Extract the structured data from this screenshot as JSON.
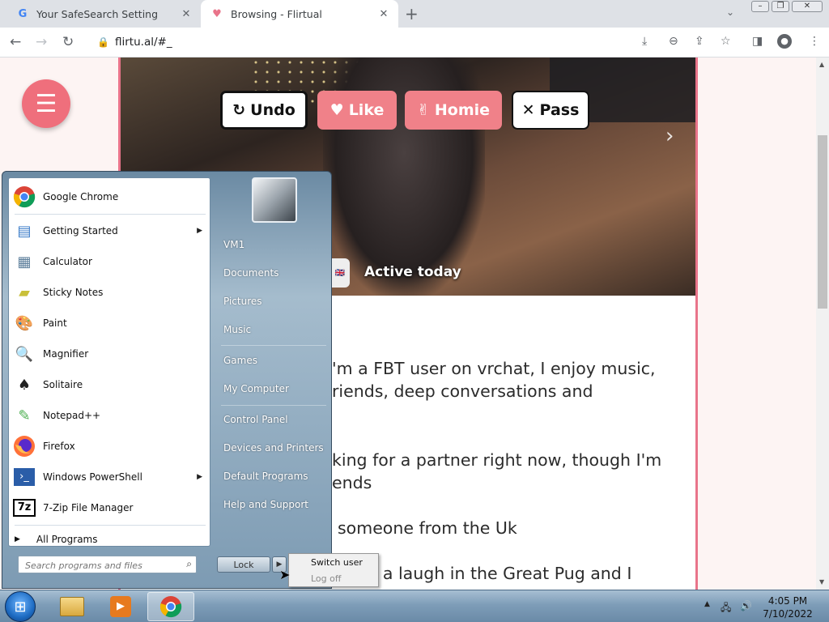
{
  "browser": {
    "tabs": [
      {
        "favicon": "G",
        "title": "Your SafeSearch Setting"
      },
      {
        "favicon": "♥",
        "title": "Browsing - Flirtual"
      }
    ],
    "url": "flirtu.al/#_"
  },
  "page": {
    "actions": [
      {
        "icon": "↻",
        "label": "Undo"
      },
      {
        "icon": "♥",
        "label": "Like"
      },
      {
        "icon": "✌",
        "label": "Homie"
      },
      {
        "icon": "✕",
        "label": "Pass"
      }
    ],
    "status": "Active today",
    "bio_lines": [
      "'m a FBT user on vrchat, I enjoy music,",
      "riends, deep conversations and",
      "king for a partner right now, though I'm",
      "ends",
      "someone from the Uk",
      "aving  a laugh in the Great Pug and I"
    ],
    "accent_color": "#f08189"
  },
  "start_menu": {
    "programs": [
      {
        "label": "Google Chrome",
        "icon": "chrome-icon",
        "submenu": false
      },
      {
        "label": "Getting Started",
        "icon": "getting-started-icon",
        "submenu": true
      },
      {
        "label": "Calculator",
        "icon": "calculator-icon",
        "submenu": false
      },
      {
        "label": "Sticky Notes",
        "icon": "sticky-notes-icon",
        "submenu": false
      },
      {
        "label": "Paint",
        "icon": "paint-icon",
        "submenu": false
      },
      {
        "label": "Magnifier",
        "icon": "magnifier-icon",
        "submenu": false
      },
      {
        "label": "Solitaire",
        "icon": "solitaire-icon",
        "submenu": false
      },
      {
        "label": "Notepad++",
        "icon": "notepadpp-icon",
        "submenu": false
      },
      {
        "label": "Firefox",
        "icon": "firefox-icon",
        "submenu": false
      },
      {
        "label": "Windows PowerShell",
        "icon": "powershell-icon",
        "submenu": true
      },
      {
        "label": "7-Zip File Manager",
        "icon": "7zip-icon",
        "submenu": false
      }
    ],
    "all_programs": "All Programs",
    "search_placeholder": "Search programs and files",
    "right_items": [
      "VM1",
      "Documents",
      "Pictures",
      "Music",
      "Games",
      "My Computer",
      "Control Panel",
      "Devices and Printers",
      "Default Programs",
      "Help and Support"
    ],
    "lock_label": "Lock",
    "power_submenu": [
      "Switch user",
      "Log off"
    ]
  },
  "taskbar": {
    "time": "4:05 PM",
    "date": "7/10/2022"
  }
}
